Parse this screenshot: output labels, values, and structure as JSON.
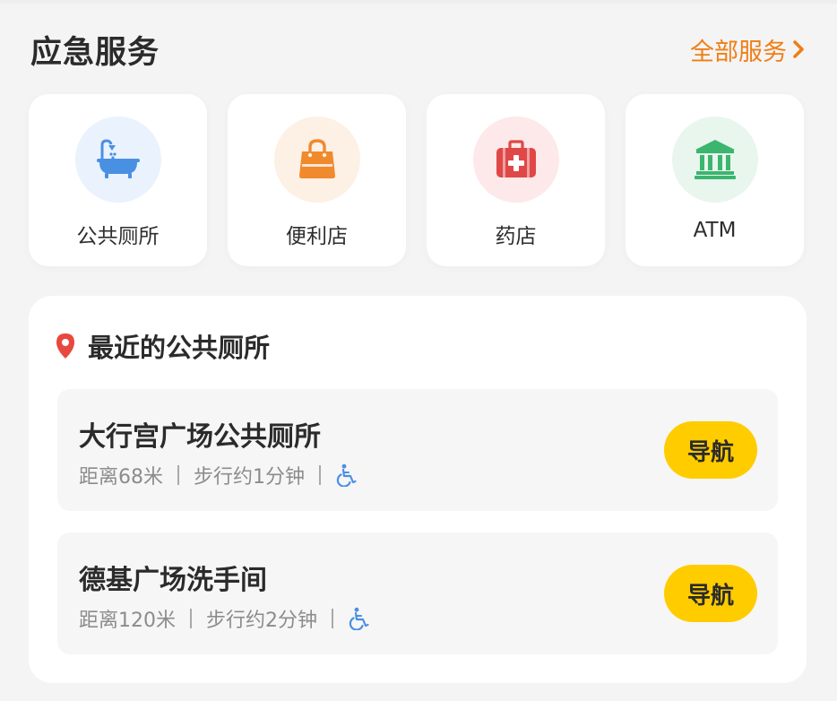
{
  "header": {
    "title": "应急服务",
    "all_services_label": "全部服务"
  },
  "services": [
    {
      "label": "公共厕所",
      "icon": "bathtub-shower-icon",
      "icon_color": "#4a90e2",
      "bg_color": "#eaf2fd"
    },
    {
      "label": "便利店",
      "icon": "shopping-bag-icon",
      "icon_color": "#f08a2c",
      "bg_color": "#fdf0e5"
    },
    {
      "label": "药店",
      "icon": "first-aid-kit-icon",
      "icon_color": "#e04848",
      "bg_color": "#fde9e9"
    },
    {
      "label": "ATM",
      "icon": "bank-building-icon",
      "icon_color": "#3cb56e",
      "bg_color": "#e8f6ee"
    }
  ],
  "nearby": {
    "title": "最近的公共厕所",
    "title_icon": "location-pin-icon",
    "items": [
      {
        "name": "大行宫广场公共厕所",
        "distance": "距离68米",
        "walk_time": "步行约1分钟",
        "accessible_icon": "wheelchair-icon",
        "nav_label": "导航"
      },
      {
        "name": "德基广场洗手间",
        "distance": "距离120米",
        "walk_time": "步行约2分钟",
        "accessible_icon": "wheelchair-icon",
        "nav_label": "导航"
      }
    ]
  },
  "colors": {
    "accent_orange": "#f07e15",
    "nav_button_yellow": "#ffcc00",
    "pin_red": "#e8483f",
    "wheelchair_blue": "#4a90e2"
  }
}
